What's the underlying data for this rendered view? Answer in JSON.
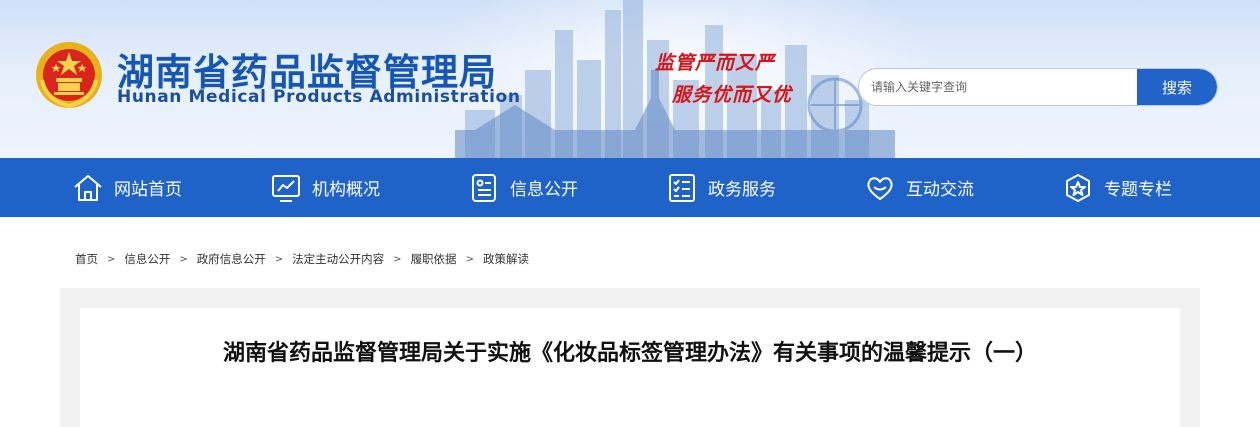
{
  "header": {
    "title": "湖南省药品监督管理局",
    "subtitle": "Hunan Medical Products Administration",
    "slogan_line1": "监管严而又严",
    "slogan_line2": "服务优而又优",
    "emblem_icon": "national-emblem-icon"
  },
  "search": {
    "placeholder": "请输入关键字查询",
    "value": "",
    "button_label": "搜索"
  },
  "nav": {
    "items": [
      {
        "label": "网站首页",
        "icon": "home-icon"
      },
      {
        "label": "机构概况",
        "icon": "chart-screen-icon"
      },
      {
        "label": "信息公开",
        "icon": "document-list-icon"
      },
      {
        "label": "政务服务",
        "icon": "checklist-icon"
      },
      {
        "label": "互动交流",
        "icon": "heart-hands-icon"
      },
      {
        "label": "专题专栏",
        "icon": "star-badge-icon"
      }
    ]
  },
  "breadcrumb": {
    "items": [
      "首页",
      "信息公开",
      "政府信息公开",
      "法定主动公开内容",
      "履职依据",
      "政策解读"
    ],
    "separator": ">"
  },
  "article": {
    "title": "湖南省药品监督管理局关于实施《化妆品标签管理办法》有关事项的温馨提示（一）"
  },
  "colors": {
    "brand_blue": "#1f62c8",
    "title_blue": "#1556b5",
    "slogan_red": "#d8141a",
    "content_bg": "#f2f2f2"
  }
}
